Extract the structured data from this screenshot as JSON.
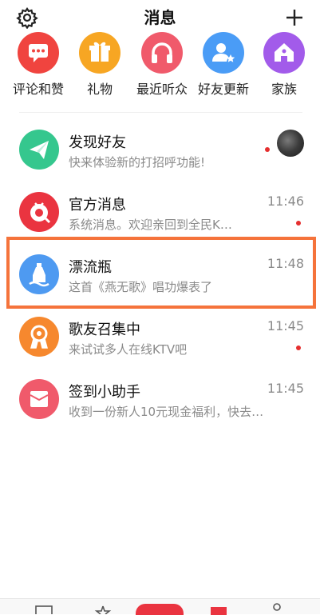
{
  "header": {
    "title": "消息"
  },
  "shortcuts": [
    {
      "label": "评论和赞",
      "icon": "comment-icon",
      "color": "#f0443f"
    },
    {
      "label": "礼物",
      "icon": "gift-icon",
      "color": "#f7a623"
    },
    {
      "label": "最近听众",
      "icon": "headphones-icon",
      "color": "#f05a6b"
    },
    {
      "label": "好友更新",
      "icon": "user-star-icon",
      "color": "#4a9cf6"
    },
    {
      "label": "家族",
      "icon": "home-icon",
      "color": "#a25bea"
    }
  ],
  "messages": [
    {
      "name": "发现好友",
      "sub": "快来体验新的打招呼功能!",
      "time": "",
      "icon": "paper-plane-icon",
      "color": "#35c78e",
      "unread": true
    },
    {
      "name": "官方消息",
      "sub": "系统消息。欢迎亲回到全民K…",
      "time": "11:46",
      "icon": "official-logo-icon",
      "color": "#ea3440",
      "unread": true
    },
    {
      "name": "漂流瓶",
      "sub": "这首《燕无歌》唱功爆表了",
      "time": "11:48",
      "icon": "bottle-icon",
      "color": "#4e9af1",
      "unread": false
    },
    {
      "name": "歌友召集中",
      "sub": "来试试多人在线KTV吧",
      "time": "11:45",
      "icon": "singer-gathering-icon",
      "color": "#f6882e",
      "unread": true
    },
    {
      "name": "签到小助手",
      "sub": "收到一份新人10元现金福利，快去…",
      "time": "11:45",
      "icon": "envelope-icon",
      "color": "#f05a6b",
      "unread": false
    }
  ]
}
